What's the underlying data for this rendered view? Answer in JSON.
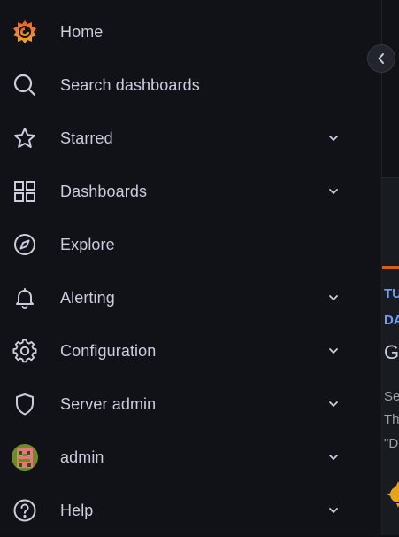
{
  "nav": {
    "items": [
      {
        "label": "Home",
        "icon": "grafana-logo-icon",
        "has_chevron": false
      },
      {
        "label": "Search dashboards",
        "icon": "search-icon",
        "has_chevron": false
      },
      {
        "label": "Starred",
        "icon": "star-icon",
        "has_chevron": true
      },
      {
        "label": "Dashboards",
        "icon": "apps-grid-icon",
        "has_chevron": true
      },
      {
        "label": "Explore",
        "icon": "compass-icon",
        "has_chevron": false
      },
      {
        "label": "Alerting",
        "icon": "bell-icon",
        "has_chevron": true
      },
      {
        "label": "Configuration",
        "icon": "gear-icon",
        "has_chevron": true
      },
      {
        "label": "Server admin",
        "icon": "shield-icon",
        "has_chevron": true
      },
      {
        "label": "admin",
        "icon": "avatar-icon",
        "has_chevron": true
      },
      {
        "label": "Help",
        "icon": "help-circle-icon",
        "has_chevron": true
      }
    ]
  },
  "main_partial": {
    "texts": [
      "TU",
      "DA",
      "G",
      "Se",
      "Th",
      "\"D"
    ]
  },
  "colors": {
    "sidebar_bg": "#111217",
    "text": "#ccccdc",
    "accent_orange": "#f56b1f",
    "link_blue": "#6e9fff"
  }
}
